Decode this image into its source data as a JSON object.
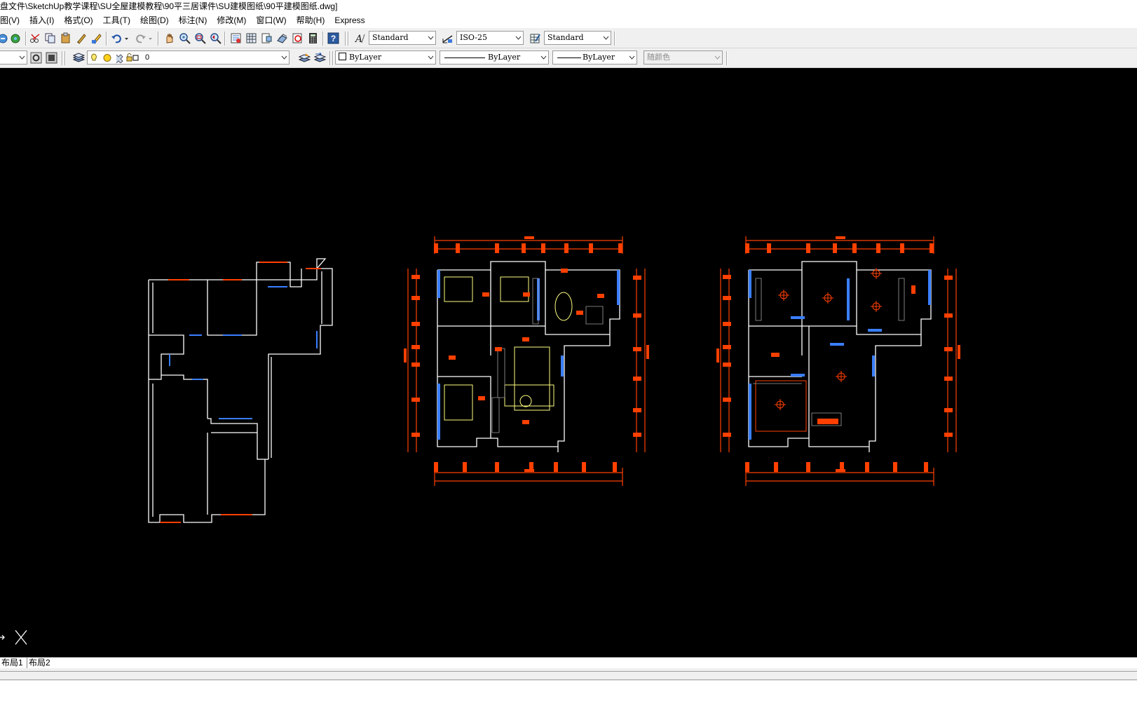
{
  "window": {
    "title": "盘文件\\SketchUp教学课程\\SU全屋建模教程\\90平三居课件\\SU建模图纸\\90平建模图纸.dwg]"
  },
  "menu": [
    "图(V)",
    "插入(I)",
    "格式(O)",
    "工具(T)",
    "绘图(D)",
    "标注(N)",
    "修改(M)",
    "窗口(W)",
    "帮助(H)",
    "Express"
  ],
  "styles_toolbar": {
    "text_style": "Standard",
    "dim_style": "ISO-25",
    "table_style": "Standard"
  },
  "layers_toolbar": {
    "current_layer": "0"
  },
  "properties_toolbar": {
    "color": "ByLayer",
    "linetype": "ByLayer",
    "lineweight": "ByLayer",
    "plot_style": "随颜色"
  },
  "layout_tabs": [
    "布局1",
    "布局2"
  ],
  "colors": {
    "canvas": "#000000",
    "dimension": "#ff4000",
    "wall": "#ffffff",
    "window_glass": "#3a7fff",
    "furniture": "#ffff80"
  }
}
